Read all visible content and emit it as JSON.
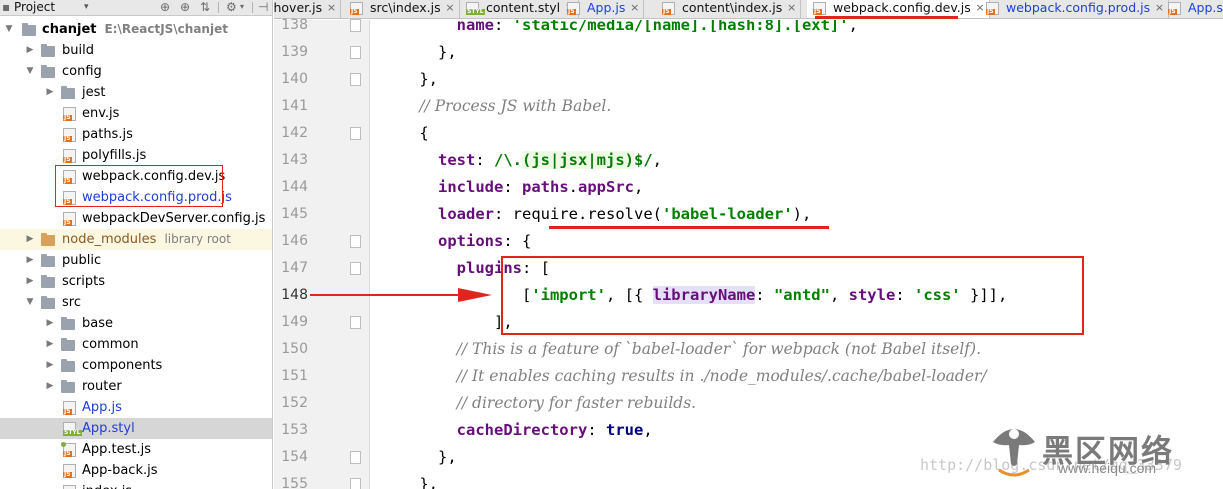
{
  "project_panel": {
    "title": "Project",
    "root_name": "chanjet",
    "root_path": "E:\\ReactJS\\chanjet",
    "tree": [
      {
        "label": "build",
        "kind": "folder",
        "expanded": false,
        "depth": 1
      },
      {
        "label": "config",
        "kind": "folder",
        "expanded": true,
        "depth": 1
      },
      {
        "label": "jest",
        "kind": "folder",
        "expanded": false,
        "depth": 2
      },
      {
        "label": "env.js",
        "kind": "js",
        "depth": 2
      },
      {
        "label": "paths.js",
        "kind": "js",
        "depth": 2
      },
      {
        "label": "polyfills.js",
        "kind": "js",
        "depth": 2
      },
      {
        "label": "webpack.config.dev.js",
        "kind": "js",
        "depth": 2
      },
      {
        "label": "webpack.config.prod.js",
        "kind": "js",
        "depth": 2,
        "color": "blue"
      },
      {
        "label": "webpackDevServer.config.js",
        "kind": "js",
        "depth": 2
      },
      {
        "label": "node_modules",
        "kind": "folder-excluded",
        "expanded": false,
        "depth": 1,
        "extra": "library root",
        "color": "brown"
      },
      {
        "label": "public",
        "kind": "folder",
        "expanded": false,
        "depth": 1
      },
      {
        "label": "scripts",
        "kind": "folder",
        "expanded": false,
        "depth": 1
      },
      {
        "label": "src",
        "kind": "folder",
        "expanded": true,
        "depth": 1
      },
      {
        "label": "base",
        "kind": "folder",
        "expanded": false,
        "depth": 2
      },
      {
        "label": "common",
        "kind": "folder",
        "expanded": false,
        "depth": 2
      },
      {
        "label": "components",
        "kind": "folder",
        "expanded": false,
        "depth": 2
      },
      {
        "label": "router",
        "kind": "folder",
        "expanded": false,
        "depth": 2
      },
      {
        "label": "App.js",
        "kind": "js",
        "depth": 2,
        "color": "blue"
      },
      {
        "label": "App.styl",
        "kind": "styl",
        "depth": 2,
        "color": "blue",
        "selected": true
      },
      {
        "label": "App.test.js",
        "kind": "test",
        "depth": 2
      },
      {
        "label": "App-back.js",
        "kind": "js",
        "depth": 2
      },
      {
        "label": "index.js",
        "kind": "js",
        "depth": 2
      }
    ]
  },
  "tabs": [
    {
      "label": "ihover.js",
      "icon": "js"
    },
    {
      "label": "src\\index.js",
      "icon": "js"
    },
    {
      "label": "content.styl",
      "icon": "styl"
    },
    {
      "label": "App.js",
      "icon": "js",
      "color": "blue"
    },
    {
      "label": "content\\index.js",
      "icon": "js"
    },
    {
      "label": "webpack.config.dev.js",
      "icon": "js",
      "active": true
    },
    {
      "label": "webpack.config.prod.js",
      "icon": "js",
      "color": "blue"
    },
    {
      "label": "App.s",
      "icon": "js",
      "color": "blue"
    }
  ],
  "editor": {
    "current_line": "148",
    "lines": [
      {
        "num": "138",
        "tokens": [
          [
            "plain",
            "        "
          ],
          [
            "prop",
            "name"
          ],
          [
            "plain",
            ": "
          ],
          [
            "str",
            "'static/media/[name].[hash:8].[ext]'"
          ],
          [
            "plain",
            ",",
            ""
          ]
        ]
      },
      {
        "num": "139",
        "tokens": [
          [
            "plain",
            "      },"
          ]
        ]
      },
      {
        "num": "140",
        "tokens": [
          [
            "plain",
            "    },"
          ]
        ]
      },
      {
        "num": "141",
        "tokens": [
          [
            "plain",
            "    "
          ],
          [
            "cmt",
            "// Process JS with Babel."
          ]
        ]
      },
      {
        "num": "142",
        "tokens": [
          [
            "plain",
            "    {"
          ]
        ]
      },
      {
        "num": "143",
        "tokens": [
          [
            "plain",
            "      "
          ],
          [
            "prop",
            "test"
          ],
          [
            "plain",
            ": "
          ],
          [
            "re",
            "/\\."
          ],
          [
            "re re-bg",
            "(js|jsx|mjs)"
          ],
          [
            "re",
            "$/"
          ],
          [
            "plain",
            ","
          ]
        ]
      },
      {
        "num": "144",
        "tokens": [
          [
            "plain",
            "      "
          ],
          [
            "prop",
            "include"
          ],
          [
            "plain",
            ": "
          ],
          [
            "prop",
            "paths"
          ],
          [
            "plain",
            "."
          ],
          [
            "prop",
            "appSrc"
          ],
          [
            "plain",
            ","
          ]
        ]
      },
      {
        "num": "145",
        "tokens": [
          [
            "plain",
            "      "
          ],
          [
            "prop",
            "loader"
          ],
          [
            "plain",
            ": require."
          ],
          [
            "plain",
            "resolve"
          ],
          [
            "plain",
            "("
          ],
          [
            "str",
            "'babel-loader'"
          ],
          [
            "plain",
            "),"
          ]
        ]
      },
      {
        "num": "146",
        "tokens": [
          [
            "plain",
            "      "
          ],
          [
            "prop",
            "options"
          ],
          [
            "plain",
            ": {"
          ]
        ]
      },
      {
        "num": "147",
        "tokens": [
          [
            "plain",
            "        "
          ],
          [
            "prop",
            "plugins"
          ],
          [
            "plain",
            ": ["
          ]
        ]
      },
      {
        "num": "148",
        "tokens": [
          [
            "plain",
            "               ["
          ],
          [
            "str",
            "'import'"
          ],
          [
            "plain",
            ", [{ "
          ],
          [
            "hl-prop",
            "libraryName"
          ],
          [
            "plain",
            ": "
          ],
          [
            "str",
            "\"antd\""
          ],
          [
            "plain",
            ", "
          ],
          [
            "prop",
            "style"
          ],
          [
            "plain",
            ": "
          ],
          [
            "str",
            "'css'"
          ],
          [
            "plain",
            " }]],"
          ]
        ]
      },
      {
        "num": "149",
        "tokens": [
          [
            "plain",
            "            ],"
          ]
        ]
      },
      {
        "num": "150",
        "tokens": [
          [
            "plain",
            "        "
          ],
          [
            "cmt",
            "// This is a feature of `babel-loader` for webpack (not Babel itself)."
          ]
        ]
      },
      {
        "num": "151",
        "tokens": [
          [
            "plain",
            "        "
          ],
          [
            "cmt",
            "// It enables caching results in ./node_modules/.cache/babel-loader/"
          ]
        ]
      },
      {
        "num": "152",
        "tokens": [
          [
            "plain",
            "        "
          ],
          [
            "cmt",
            "// directory for faster rebuilds."
          ]
        ]
      },
      {
        "num": "153",
        "tokens": [
          [
            "plain",
            "        "
          ],
          [
            "prop",
            "cacheDirectory"
          ],
          [
            "plain",
            ": "
          ],
          [
            "kw",
            "true"
          ],
          [
            "plain",
            ","
          ]
        ]
      },
      {
        "num": "154",
        "tokens": [
          [
            "plain",
            "      },"
          ]
        ]
      },
      {
        "num": "155",
        "tokens": [
          [
            "plain",
            "    },"
          ]
        ]
      }
    ]
  },
  "watermark": {
    "url_text": "http://blog.csdn.net/qq_33379",
    "cn_text": "黑区网络",
    "domain_text": "www.heiqu.com"
  },
  "colors": {
    "annotation_red": "#e0261c",
    "keyword_navy": "#000080",
    "string_green": "#008000",
    "property_purple": "#660e7a",
    "comment_gray": "#808080"
  }
}
